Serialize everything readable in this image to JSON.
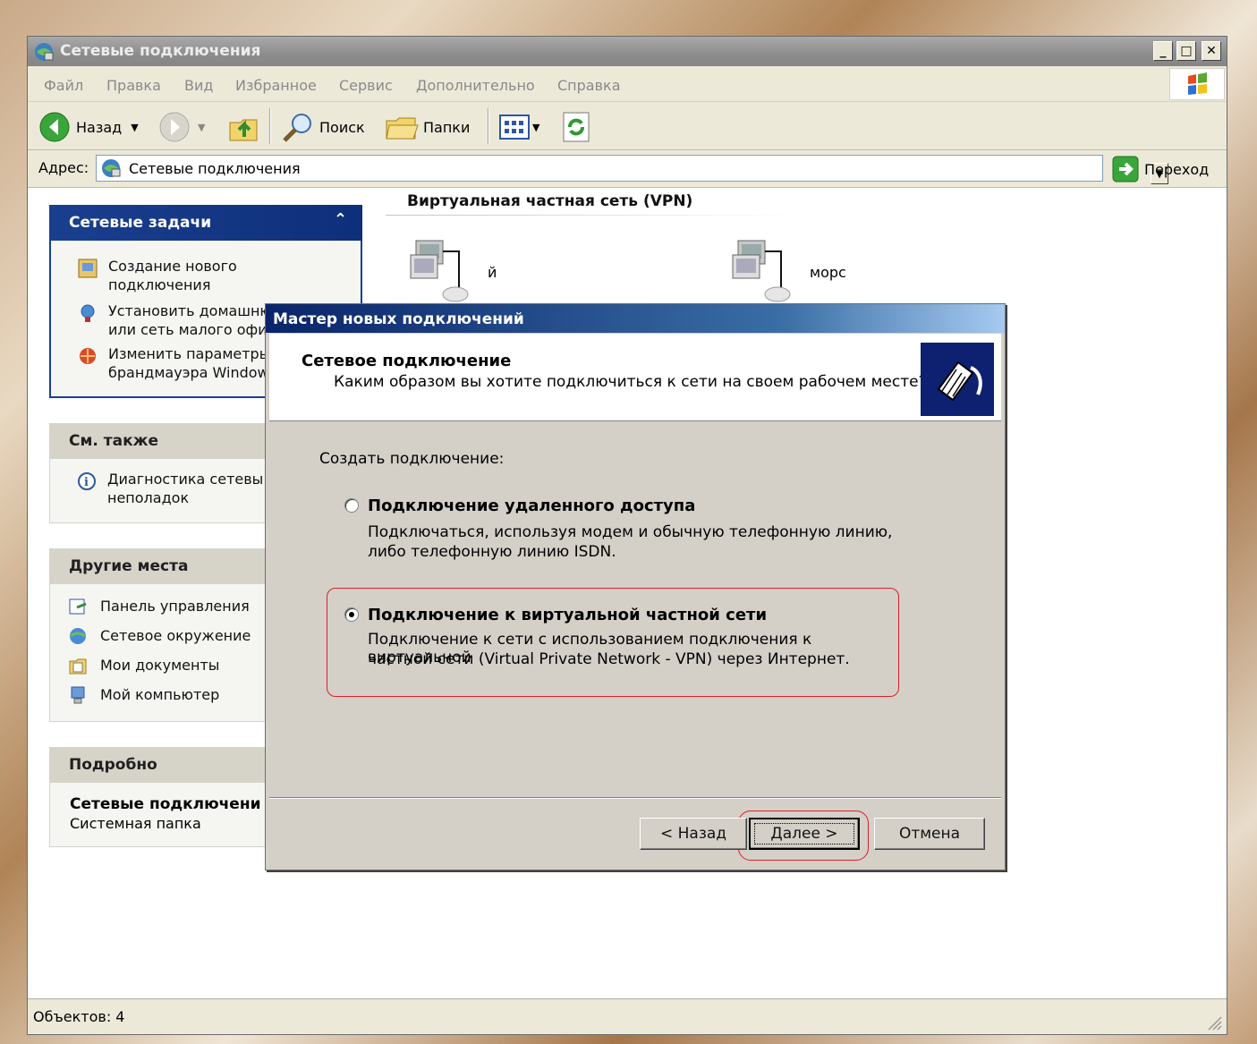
{
  "explorer": {
    "title": "Сетевые подключения",
    "menu": [
      "Файл",
      "Правка",
      "Вид",
      "Избранное",
      "Сервис",
      "Дополнительно",
      "Справка"
    ],
    "toolbar": {
      "back_label": "Назад",
      "search_label": "Поиск",
      "folders_label": "Папки"
    },
    "address": {
      "label": "Адрес:",
      "value": "Сетевые подключения",
      "go_label": "Переход"
    },
    "status": "Объектов: 4"
  },
  "task_pane": {
    "network_tasks": {
      "title": "Сетевые задачи",
      "items": [
        {
          "line1": "Создание нового",
          "line2": "подключения"
        },
        {
          "line1": "Установить домашню",
          "line2": "или сеть малого офи"
        },
        {
          "line1": "Изменить параметры",
          "line2": "брандмауэра Window"
        }
      ]
    },
    "see_also": {
      "title": "См. также",
      "items": [
        {
          "line1": "Диагностика сетевы",
          "line2": "неполадок"
        }
      ]
    },
    "other_places": {
      "title": "Другие места",
      "items": [
        "Панель управления",
        "Сетевое окружение",
        "Мои документы",
        "Мой компьютер"
      ]
    },
    "details": {
      "title": "Подробно",
      "name": "Сетевые подключени",
      "type": "Системная папка"
    }
  },
  "content": {
    "group_header": "Виртуальная частная сеть (VPN)",
    "connections": [
      {
        "name": "й"
      },
      {
        "name": "морс"
      }
    ]
  },
  "wizard": {
    "title": "Мастер новых подключений",
    "heading": "Сетевое подключение",
    "subheading": "Каким образом вы хотите подключиться к сети на своем рабочем месте?",
    "create_label": "Создать подключение:",
    "options": [
      {
        "label": "Подключение удаленного доступа",
        "desc1": "Подключаться, используя модем и обычную телефонную линию,",
        "desc2": "либо телефонную линию ISDN.",
        "checked": false
      },
      {
        "label": "Подключение к виртуальной частной сети",
        "desc1": "Подключение к сети с использованием подключения к виртуальной",
        "desc2": "частной сети (Virtual Private Network - VPN) через Интернет.",
        "checked": true
      }
    ],
    "buttons": {
      "back": "< Назад",
      "next": "Далее >",
      "cancel": "Отмена"
    }
  },
  "colors": {
    "highlight": "#d8202a",
    "wizard_title": "#0a246a"
  }
}
